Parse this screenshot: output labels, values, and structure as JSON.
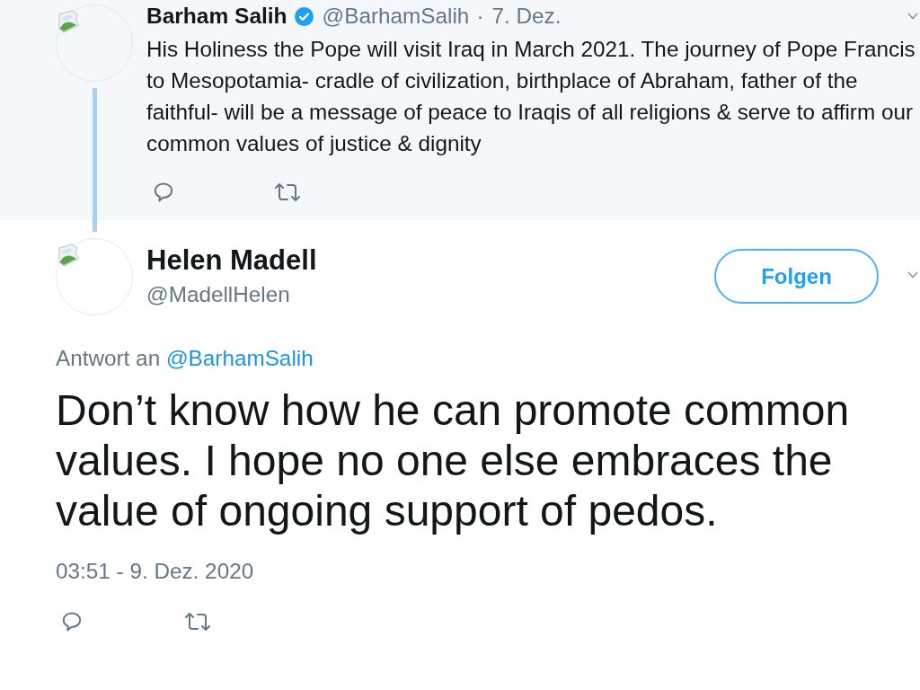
{
  "parent_tweet": {
    "author": {
      "name": "Barham Salih",
      "verified": true,
      "handle": "@BarhamSalih"
    },
    "separator": "·",
    "date": "7. Dez.",
    "text_lines": [
      "His Holiness the Pope will visit Iraq in March 2021. The journey of Pope Francis",
      "to Mesopotamia- cradle of civilization, birthplace of Abraham, father of the",
      "faithful- will be a message of peace to Iraqis of all religions & serve to affirm our",
      "common values of justice & dignity"
    ],
    "actions": [
      {
        "kind": "reply"
      },
      {
        "kind": "retweet"
      }
    ]
  },
  "reply_tweet": {
    "author": {
      "name": "Helen Madell",
      "handle": "@MadellHelen"
    },
    "follow_button": {
      "label": "Folgen"
    },
    "reply_to": {
      "text": "Antwort an",
      "mention": "@BarhamSalih"
    },
    "text_lines": [
      "Don’t know how he can promote common",
      "values. I hope no one else embraces the",
      "value of ongoing support of pedos."
    ],
    "timestamp": "03:51 - 9. Dez. 2020",
    "actions": [
      {
        "kind": "reply"
      },
      {
        "kind": "retweet"
      }
    ]
  }
}
